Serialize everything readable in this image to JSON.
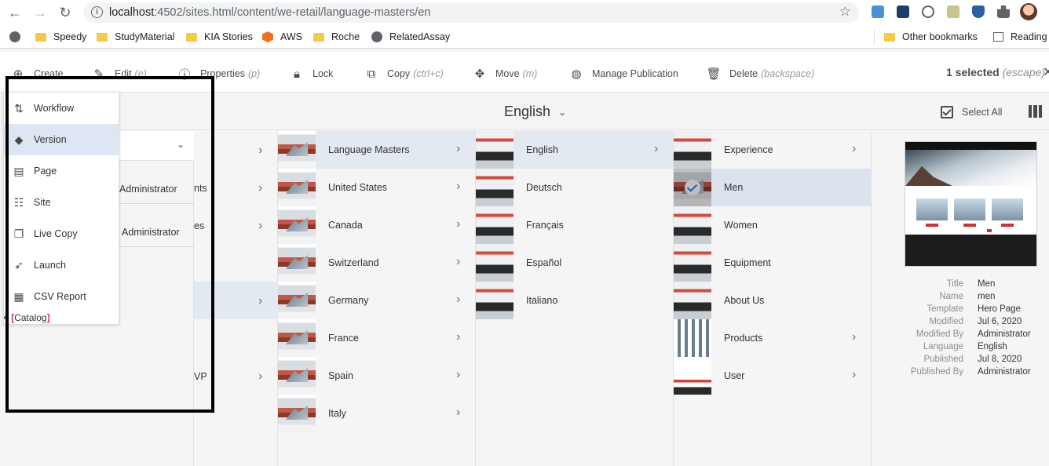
{
  "browser": {
    "url_host": "localhost",
    "url_path": ":4502/sites.html/content/we-retail/language-masters/en",
    "bookmarks": [
      "Speedy",
      "StudyMaterial",
      "KIA Stories",
      "AWS",
      "Roche",
      "RelatedAssay"
    ],
    "other_bookmarks": "Other bookmarks",
    "reading_list": "Reading l"
  },
  "actionbar": {
    "create": "Create",
    "edit": "Edit",
    "edit_key": "(e)",
    "properties": "Properties",
    "properties_key": "(p)",
    "lock": "Lock",
    "copy": "Copy",
    "copy_key": "(ctrl+c)",
    "move": "Move",
    "move_key": "(m)",
    "manage_publication": "Manage Publication",
    "delete": "Delete",
    "delete_key": "(backspace)",
    "selected": "1 selected",
    "selected_key": "(escape)"
  },
  "header": {
    "title": "English",
    "select_all": "Select All"
  },
  "create_menu": {
    "items": [
      "Workflow",
      "Version",
      "Page",
      "Site",
      "Live Copy",
      "Launch",
      "CSV Report"
    ],
    "active_item": "Version",
    "catalog": "Catalog"
  },
  "left_peek": {
    "admin1": "Administrator",
    "admin2": "Administrator",
    "nts": "nts",
    "es": "es",
    "vp": "VP"
  },
  "col_sites": [
    "Language Masters",
    "United States",
    "Canada",
    "Switzerland",
    "Germany",
    "France",
    "Spain",
    "Italy"
  ],
  "col_languages": [
    "English",
    "Deutsch",
    "Français",
    "Español",
    "Italiano"
  ],
  "col_pages": [
    "Experience",
    "Men",
    "Women",
    "Equipment",
    "About Us",
    "Products",
    "User"
  ],
  "preview": {
    "meta": [
      {
        "k": "Title",
        "v": "Men"
      },
      {
        "k": "Name",
        "v": "men"
      },
      {
        "k": "Template",
        "v": "Hero Page"
      },
      {
        "k": "Modified",
        "v": "Jul 6, 2020"
      },
      {
        "k": "Modified By",
        "v": "Administrator"
      },
      {
        "k": "Language",
        "v": "English"
      },
      {
        "k": "Published",
        "v": "Jul 8, 2020"
      },
      {
        "k": "Published By",
        "v": "Administrator"
      }
    ]
  }
}
